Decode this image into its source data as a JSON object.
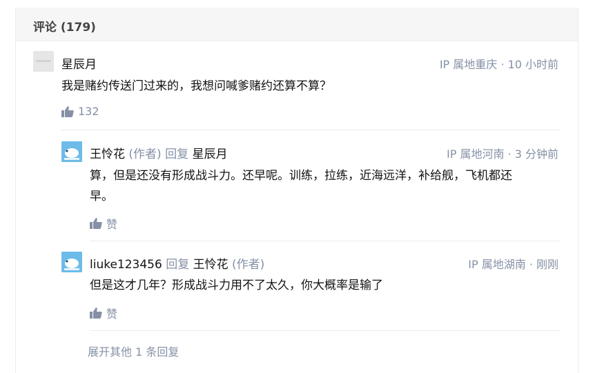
{
  "header": {
    "title": "评论 (179)"
  },
  "comments": [
    {
      "username": "星辰月",
      "meta": "IP 属地重庆 · 10 小时前",
      "text": "我是赌约传送门过来的，我想问喊爹赌约还算不算？",
      "likes": "132"
    }
  ],
  "replies": [
    {
      "username": "王怜花",
      "author_tag": "(作者)",
      "reply_word": "回复",
      "reply_to": "星辰月",
      "meta": "IP 属地河南 · 3 分钟前",
      "text_line1": "算，但是还没有形成战斗力。还早呢。训练，拉练，近海远洋，补给舰，飞机都还",
      "text_line2": "早。",
      "like_label": "赞"
    },
    {
      "username": "liuke123456",
      "reply_word": "回复",
      "reply_to": "王怜花",
      "reply_to_tag": "(作者)",
      "meta": "IP 属地湖南 · 刚刚",
      "text": "但是这才几年？形成战斗力用不了太久，你大概率是输了",
      "like_label": "赞"
    }
  ],
  "expand": {
    "label": "展开其他 1 条回复"
  },
  "icons": {
    "like": "thumbs-up-icon"
  },
  "colors": {
    "meta": "#8590a6",
    "text": "#121212",
    "header_bg": "#f6f6f6"
  }
}
